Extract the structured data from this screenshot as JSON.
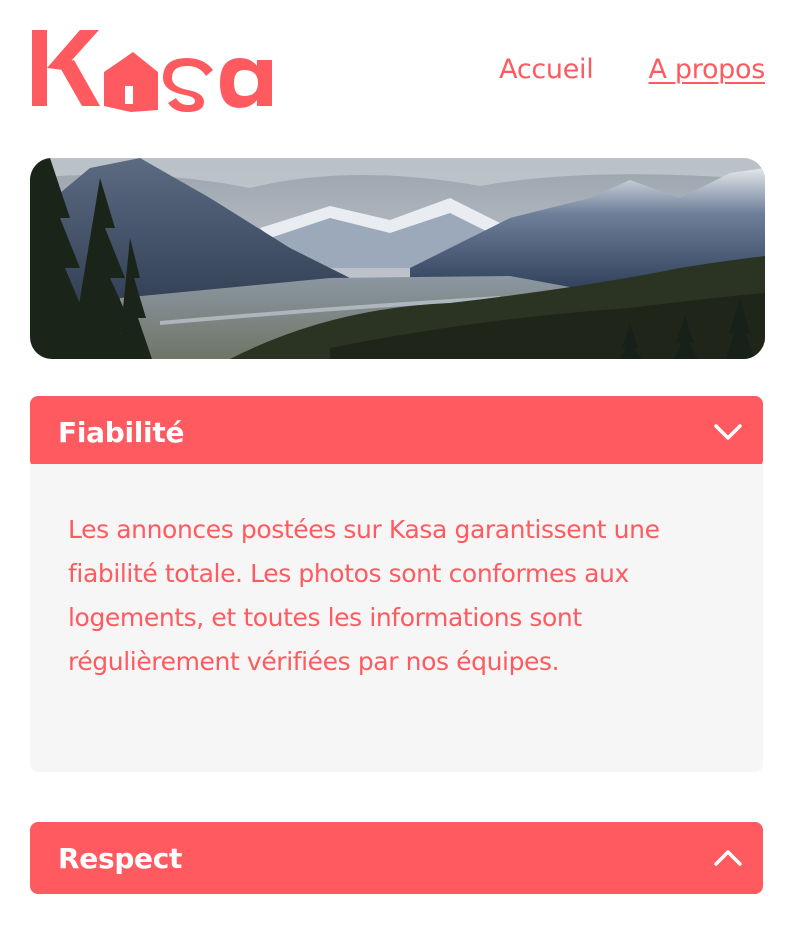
{
  "brand": {
    "logo_text": "Kasa",
    "accent_color": "#ff5a5f"
  },
  "nav": {
    "items": [
      {
        "label": "Accueil",
        "active": false
      },
      {
        "label": "A propos",
        "active": true
      }
    ]
  },
  "banner": {
    "image_subject": "mountain landscape"
  },
  "collapses": [
    {
      "title": "Fiabilité",
      "state": "expanded",
      "icon": "chevron-down-icon",
      "content": "Les annonces postées sur Kasa garantissent une fiabilité totale. Les photos sont conformes aux logements, et toutes les informations sont régulièrement vérifiées par nos équipes."
    },
    {
      "title": "Respect",
      "state": "collapsed",
      "icon": "chevron-up-icon",
      "content": ""
    }
  ]
}
